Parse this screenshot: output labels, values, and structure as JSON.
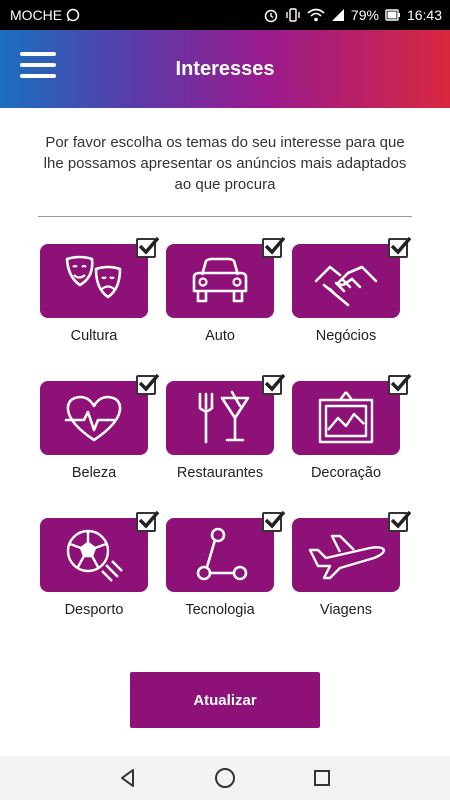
{
  "status_bar": {
    "carrier": "MOCHE",
    "battery": "79%",
    "time": "16:43",
    "icons": [
      "whatsapp-icon",
      "alarm-icon",
      "vibrate-icon",
      "wifi-icon",
      "signal-icon",
      "battery-icon"
    ]
  },
  "app_bar": {
    "title": "Interesses",
    "menu_icon": "hamburger-icon"
  },
  "intro_text": "Por favor escolha os temas do seu interesse para que lhe possamos apresentar os anúncios mais adaptados ao que procura",
  "categories": [
    {
      "label": "Cultura",
      "icon": "theater-masks-icon",
      "checked": true
    },
    {
      "label": "Auto",
      "icon": "car-icon",
      "checked": true
    },
    {
      "label": "Negócios",
      "icon": "handshake-icon",
      "checked": true
    },
    {
      "label": "Beleza",
      "icon": "heart-pulse-icon",
      "checked": true
    },
    {
      "label": "Restaurantes",
      "icon": "fork-cocktail-icon",
      "checked": true
    },
    {
      "label": "Decoração",
      "icon": "picture-frame-icon",
      "checked": true
    },
    {
      "label": "Desporto",
      "icon": "soccer-ball-icon",
      "checked": true
    },
    {
      "label": "Tecnologia",
      "icon": "share-nodes-icon",
      "checked": true
    },
    {
      "label": "Viagens",
      "icon": "airplane-icon",
      "checked": true
    }
  ],
  "update_button": "Atualizar",
  "nav_bar": {
    "icons": [
      "back-icon",
      "home-icon",
      "recents-icon"
    ]
  },
  "colors": {
    "accent": "#8e1177",
    "gradient_start": "#1a6fc0",
    "gradient_end": "#d8283f"
  }
}
